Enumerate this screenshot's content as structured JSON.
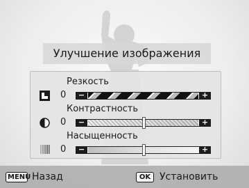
{
  "dialog": {
    "title": "Улучшение изображения"
  },
  "rows": [
    {
      "label": "Резкость",
      "value": "0",
      "icon": "sharpness-icon",
      "level": 0.5
    },
    {
      "label": "Контрастность",
      "value": "0",
      "icon": "contrast-icon",
      "level": 0.5
    },
    {
      "label": "Насыщенность",
      "value": "0",
      "icon": "saturation-icon",
      "level": 0.5
    }
  ],
  "slider": {
    "minus": "−",
    "plus": "+"
  },
  "footer": {
    "menu_badge": "MENU",
    "back_label": "Назад",
    "ok_badge": "OK",
    "set_label": "Установить"
  }
}
